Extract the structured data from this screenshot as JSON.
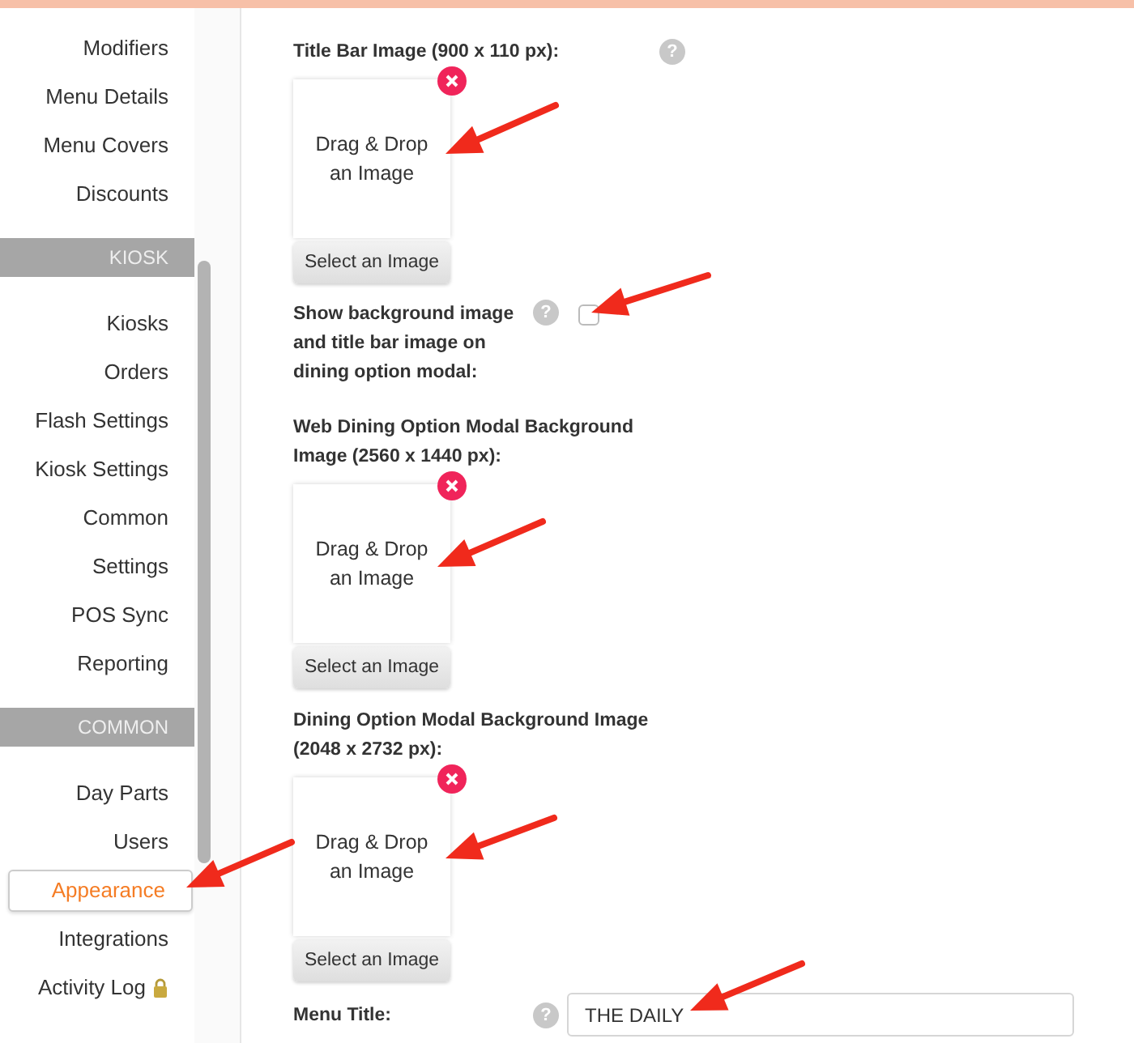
{
  "sidebar": {
    "items": [
      {
        "kind": "item",
        "label": "Modifiers",
        "selected": false
      },
      {
        "kind": "item",
        "label": "Menu Details",
        "selected": false
      },
      {
        "kind": "item",
        "label": "Menu Covers",
        "selected": false
      },
      {
        "kind": "item",
        "label": "Discounts",
        "selected": false
      },
      {
        "kind": "header",
        "label": "KIOSK"
      },
      {
        "kind": "item",
        "label": "Kiosks",
        "selected": false
      },
      {
        "kind": "item",
        "label": "Orders",
        "selected": false
      },
      {
        "kind": "item",
        "label": "Flash Settings",
        "selected": false
      },
      {
        "kind": "item",
        "label": "Kiosk Settings",
        "selected": false
      },
      {
        "kind": "item",
        "label": "Common",
        "selected": false
      },
      {
        "kind": "item",
        "label": "Settings",
        "selected": false
      },
      {
        "kind": "item",
        "label": "POS Sync",
        "selected": false
      },
      {
        "kind": "item",
        "label": "Reporting",
        "selected": false
      },
      {
        "kind": "header",
        "label": "COMMON"
      },
      {
        "kind": "item",
        "label": "Day Parts",
        "selected": false
      },
      {
        "kind": "item",
        "label": "Users",
        "selected": false
      },
      {
        "kind": "item",
        "label": "Appearance",
        "selected": true
      },
      {
        "kind": "item",
        "label": "Integrations",
        "selected": false
      },
      {
        "kind": "item",
        "label": "Activity Log",
        "selected": false,
        "locked": true
      }
    ]
  },
  "fields": [
    {
      "kind": "image",
      "label": "Title Bar Image (900 x 110 px):",
      "help": "?",
      "drop_text": "Drag & Drop an Image",
      "button": "Select an Image"
    },
    {
      "kind": "checkbox",
      "label": "Show background image and title bar image on dining option modal:",
      "help": "?",
      "checked": false
    },
    {
      "kind": "image",
      "label": "Web Dining Option Modal Background Image (2560 x 1440 px):",
      "drop_text": "Drag & Drop an Image",
      "button": "Select an Image"
    },
    {
      "kind": "image",
      "label": "Dining Option Modal Background Image (2048 x 2732 px):",
      "drop_text": "Drag & Drop an Image",
      "button": "Select an Image"
    },
    {
      "kind": "text",
      "label": "Menu Title:",
      "help": "?",
      "value": "THE DAILY"
    }
  ]
}
